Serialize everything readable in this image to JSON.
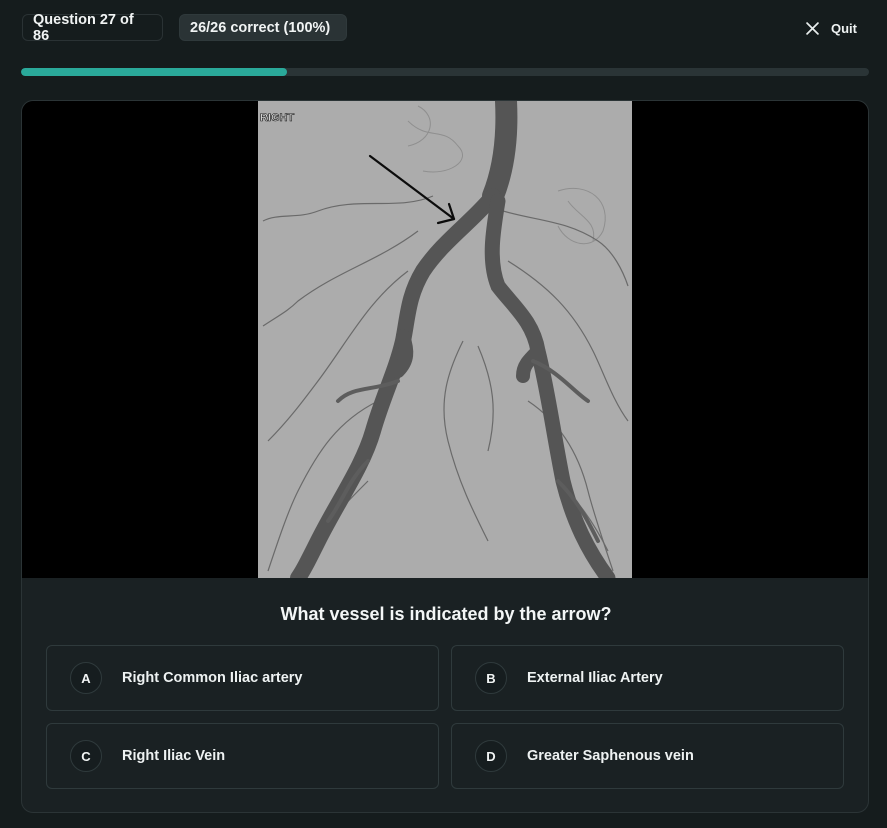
{
  "header": {
    "question_counter": "Question 27 of 86",
    "score": "26/26 correct (100%)",
    "quit_label": "Quit",
    "progress_fraction": 0.314
  },
  "image": {
    "overlay_label": "RIGHT"
  },
  "question": {
    "text": "What vessel is indicated by the arrow?"
  },
  "options": [
    {
      "letter": "A",
      "label": "Right Common Iliac artery"
    },
    {
      "letter": "B",
      "label": "External Iliac Artery"
    },
    {
      "letter": "C",
      "label": "Right Iliac Vein"
    },
    {
      "letter": "D",
      "label": "Greater Saphenous vein"
    }
  ],
  "colors": {
    "background": "#151c1d",
    "accent": "#2aa99a",
    "card": "#1a2123"
  }
}
